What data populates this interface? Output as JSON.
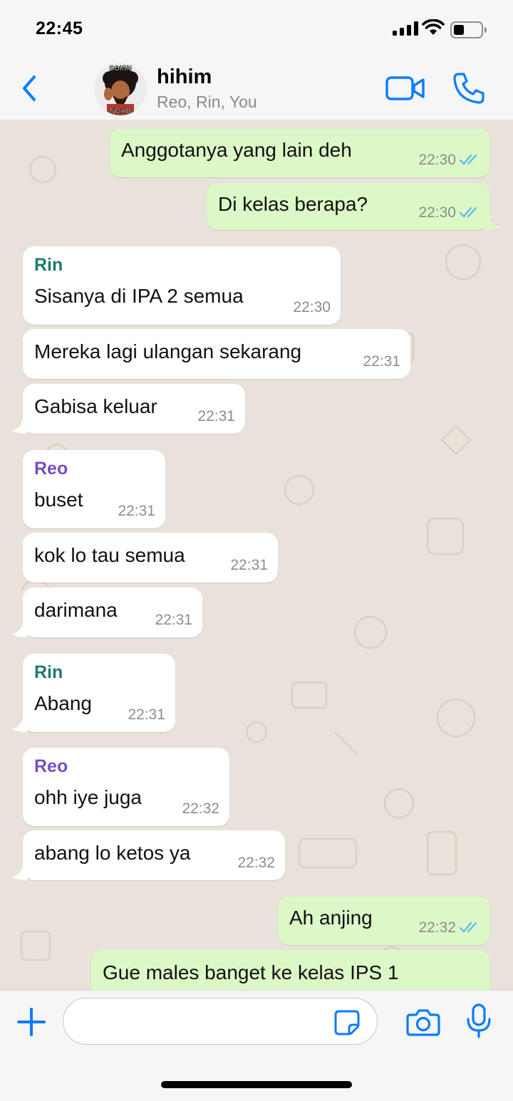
{
  "status_bar": {
    "time": "22:45"
  },
  "header": {
    "title": "hihim",
    "subtitle": "Reo, Rin, You",
    "avatar_text_top": "SOKIN",
    "avatar_text_bottom": "NGAB"
  },
  "colors": {
    "accent": "#0a7cff",
    "outgoing_bubble": "#dcf8c6",
    "incoming_bubble": "#ffffff",
    "rin_name": "#1f7a6e",
    "reo_name": "#7a4cc2",
    "read_ticks": "#53bdeb"
  },
  "messages": [
    {
      "direction": "out",
      "text": "Anggotanya yang lain deh",
      "time": "22:30",
      "status": "read"
    },
    {
      "direction": "out",
      "text": "Di kelas berapa?",
      "time": "22:30",
      "status": "read"
    },
    {
      "direction": "in",
      "sender": "Rin",
      "text": "Sisanya di IPA 2 semua",
      "time": "22:30"
    },
    {
      "direction": "in",
      "text": "Mereka lagi ulangan sekarang",
      "time": "22:31"
    },
    {
      "direction": "in",
      "text": "Gabisa keluar",
      "time": "22:31"
    },
    {
      "direction": "in",
      "sender": "Reo",
      "text": "buset",
      "time": "22:31"
    },
    {
      "direction": "in",
      "text": "kok lo tau semua",
      "time": "22:31"
    },
    {
      "direction": "in",
      "text": "darimana",
      "time": "22:31"
    },
    {
      "direction": "in",
      "sender": "Rin",
      "text": "Abang",
      "time": "22:31"
    },
    {
      "direction": "in",
      "sender": "Reo",
      "text": "ohh iye juga",
      "time": "22:32"
    },
    {
      "direction": "in",
      "text": "abang lo ketos ya",
      "time": "22:32"
    },
    {
      "direction": "out",
      "text": "Ah anjing",
      "time": "22:32",
      "status": "read"
    },
    {
      "direction": "out",
      "text": "Gue males banget ke kelas IPS 1",
      "time": ""
    }
  ],
  "input": {
    "placeholder": ""
  },
  "icons": {
    "back": "chevron-left-icon",
    "video": "video-camera-icon",
    "call": "phone-icon",
    "plus": "plus-icon",
    "sticker": "sticker-icon",
    "camera": "camera-icon",
    "mic": "microphone-icon"
  }
}
